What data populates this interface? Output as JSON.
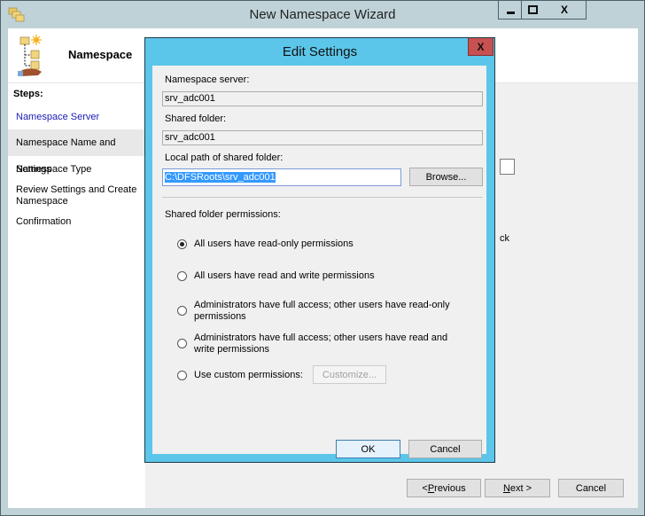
{
  "window": {
    "title": "New Namespace Wizard",
    "controls": {
      "minimize": "minimize",
      "maximize": "maximize",
      "close": "X"
    }
  },
  "header": {
    "title": "Namespace"
  },
  "steps": {
    "title": "Steps:",
    "items": [
      {
        "label": "Namespace Server",
        "state": "active"
      },
      {
        "label": "Namespace Name and Settings",
        "state": "selected"
      },
      {
        "label": "Namespace Type",
        "state": "normal"
      },
      {
        "label": "Review Settings and Create Namespace",
        "state": "normal"
      },
      {
        "label": "Confirmation",
        "state": "normal"
      }
    ]
  },
  "main": {
    "partial_text": "ck"
  },
  "footer": {
    "previous_prefix": "< ",
    "previous_key": "P",
    "previous_rest": "revious",
    "next_key": "N",
    "next_rest": "ext >",
    "cancel": "Cancel"
  },
  "dialog": {
    "title": "Edit Settings",
    "close": "X",
    "namespace_server_label": "Namespace server:",
    "namespace_server_value": "srv_adc001",
    "shared_folder_label": "Shared folder:",
    "shared_folder_value": "srv_adc001",
    "local_path_label": "Local path of shared folder:",
    "local_path_value": "C:\\DFSRoots\\srv_adc001",
    "browse": "Browse...",
    "permissions_label": "Shared folder permissions:",
    "permissions": [
      {
        "label": "All users have read-only permissions",
        "selected": true
      },
      {
        "label": "All users have read and write permissions",
        "selected": false
      },
      {
        "label": "Administrators have full access; other users have read-only permissions",
        "selected": false
      },
      {
        "label": "Administrators have full access; other users have read and write permissions",
        "selected": false
      },
      {
        "label": "Use custom permissions:",
        "selected": false
      }
    ],
    "customize": "Customize...",
    "ok": "OK",
    "cancel": "Cancel"
  },
  "colors": {
    "dialog_frame": "#5cc6ea",
    "close_button": "#c75050",
    "selection": "#3399ff",
    "active_step": "#1b1bb5"
  }
}
